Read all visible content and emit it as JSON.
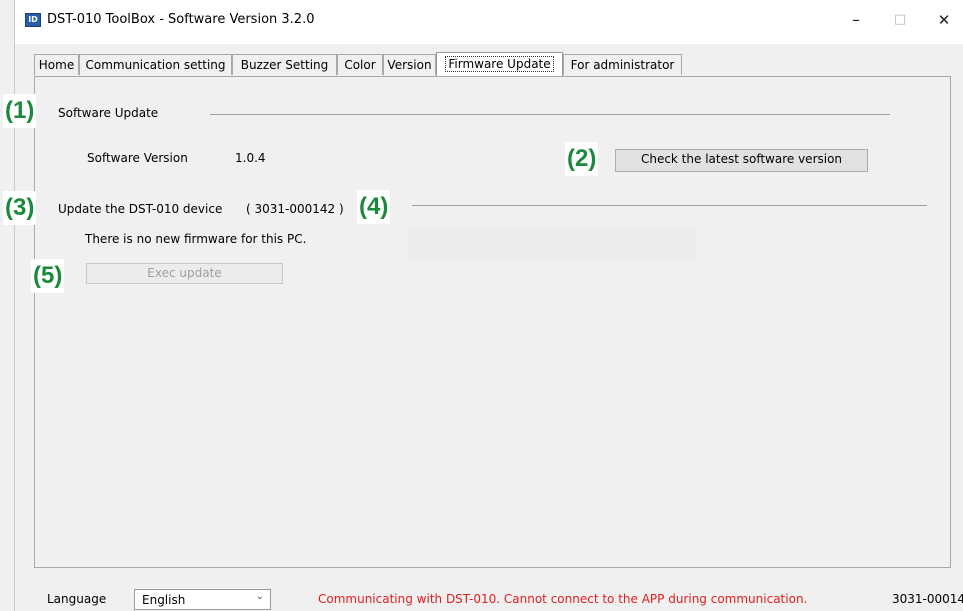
{
  "window": {
    "title": "DST-010 ToolBox - Software Version 3.2.0",
    "app_icon": "dst-app-icon",
    "controls": {
      "minimize": "–",
      "maximize": "□",
      "close": "✕"
    }
  },
  "tabs": [
    {
      "label": "Home"
    },
    {
      "label": "Communication setting"
    },
    {
      "label": "Buzzer Setting"
    },
    {
      "label": "Color"
    },
    {
      "label": "Version"
    },
    {
      "label": "Firmware Update",
      "active": true
    },
    {
      "label": "For administrator"
    }
  ],
  "markers": [
    "(1)",
    "(2)",
    "(3)",
    "(4)",
    "(5)"
  ],
  "software_update": {
    "group_label": "Software Update",
    "version_label": "Software Version",
    "version_value": "1.0.4",
    "check_button": "Check the latest software version"
  },
  "device_update": {
    "group_label": "Update the DST-010 device",
    "device_id": "( 3031-000142 )",
    "message": "There is no new firmware for this PC.",
    "exec_button": "Exec update"
  },
  "statusbar": {
    "language_label": "Language",
    "language_value": "English",
    "status_message": "Communicating with DST-010. Cannot connect to the APP during communication.",
    "device_id": "3031-00014"
  },
  "colors": {
    "marker": "#1a8a3a",
    "status_error": "#e02020"
  }
}
